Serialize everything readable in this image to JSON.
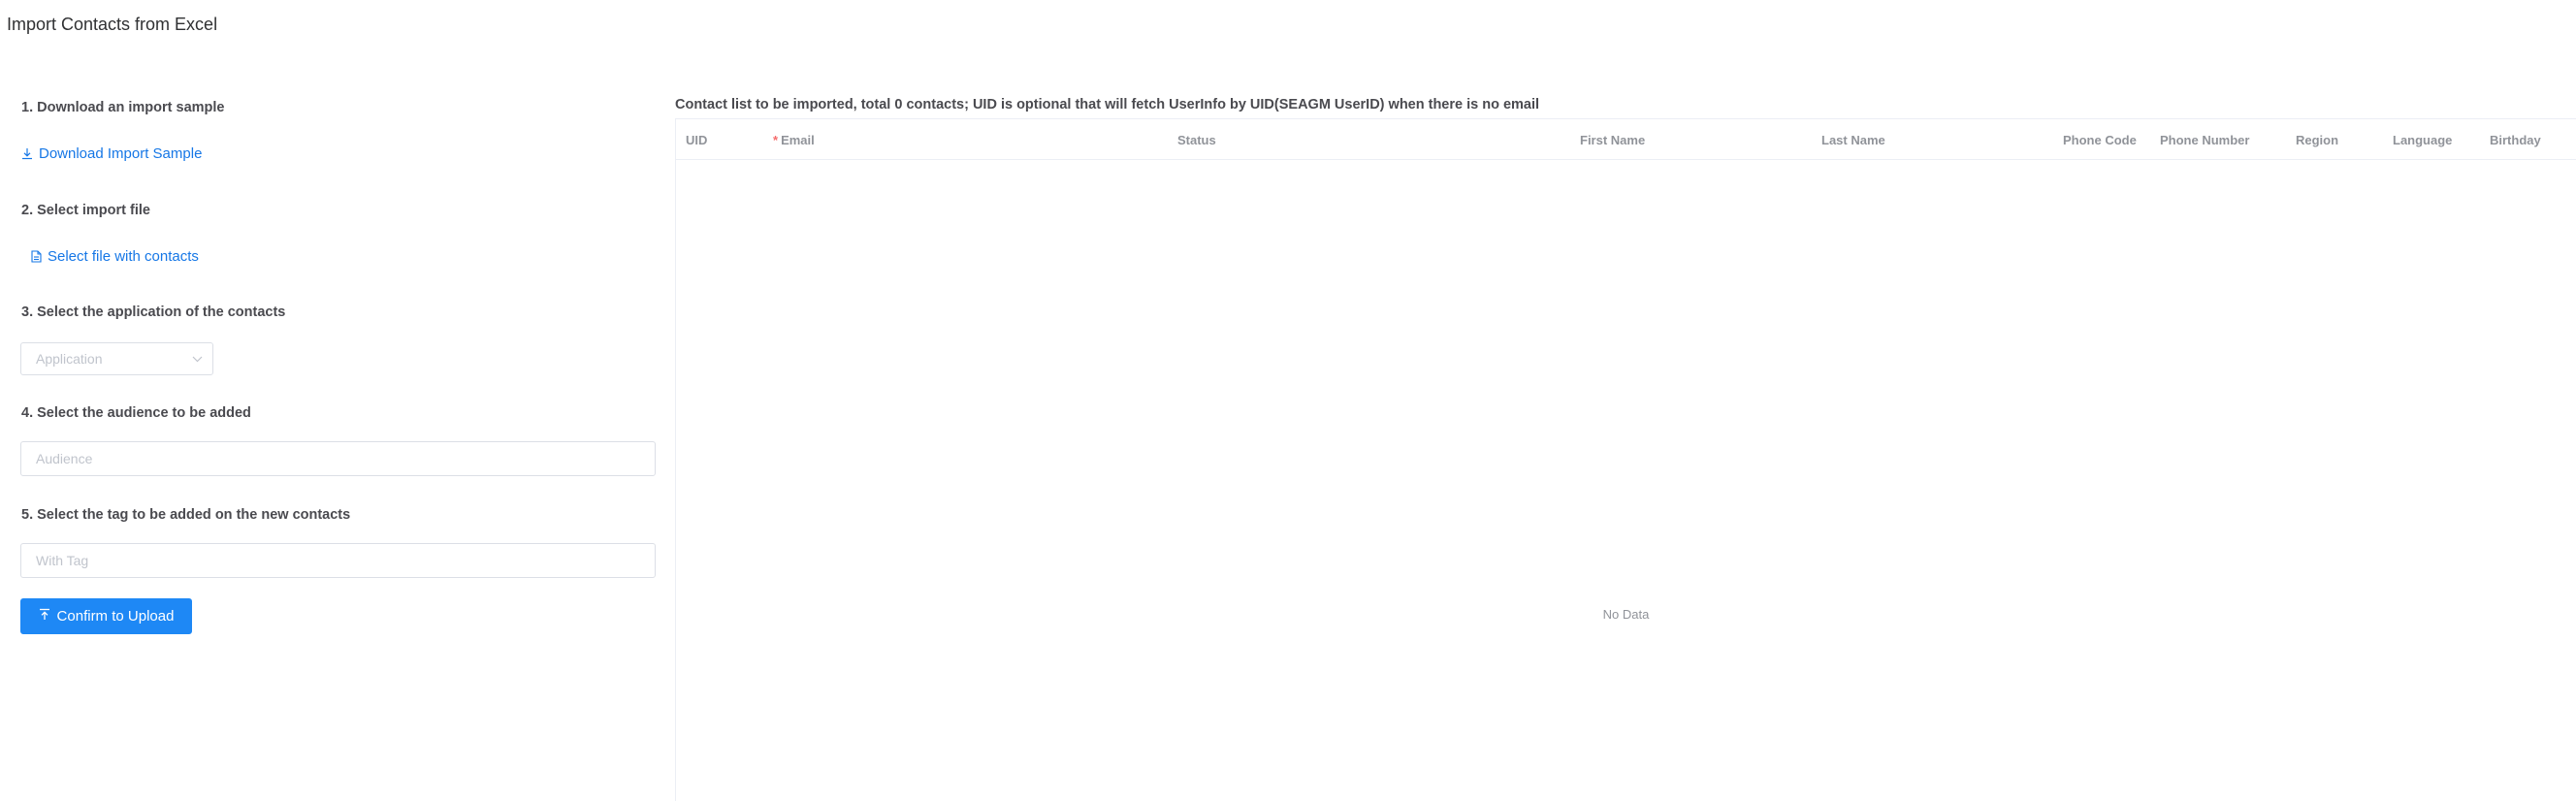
{
  "page": {
    "title": "Import Contacts from Excel"
  },
  "steps": {
    "download": {
      "title": "1. Download an import sample",
      "link_label": "Download Import Sample"
    },
    "file": {
      "title": "2. Select import file",
      "link_label": "Select file with contacts"
    },
    "application": {
      "title": "3. Select the application of the contacts",
      "placeholder": "Application"
    },
    "audience": {
      "title": "4. Select the audience to be added",
      "placeholder": "Audience"
    },
    "tag": {
      "title": "5. Select the tag to be added on the new contacts",
      "placeholder": "With Tag"
    },
    "confirm_label": "Confirm to Upload"
  },
  "table": {
    "caption": "Contact list to be imported, total 0 contacts; UID is optional that will fetch UserInfo by UID(SEAGM UserID) when there is no email",
    "columns": [
      {
        "label": "UID",
        "required": false
      },
      {
        "label": "Email",
        "required": true,
        "required_mark": "*"
      },
      {
        "label": "Status",
        "required": false
      },
      {
        "label": "First Name",
        "required": false
      },
      {
        "label": "Last Name",
        "required": false
      },
      {
        "label": "Phone Code",
        "required": false
      },
      {
        "label": "Phone Number",
        "required": false
      },
      {
        "label": "Region",
        "required": false
      },
      {
        "label": "Language",
        "required": false
      },
      {
        "label": "Birthday",
        "required": false
      }
    ],
    "empty_text": "No Data"
  },
  "icons": {
    "download": "download-icon",
    "file": "document-icon",
    "select_arrow": "chevron-down-icon",
    "upload": "upload-icon"
  },
  "colors": {
    "link": "#1677e6",
    "primary": "#1e88f5",
    "required": "#f56c6c",
    "border": "#dcdfe6"
  }
}
